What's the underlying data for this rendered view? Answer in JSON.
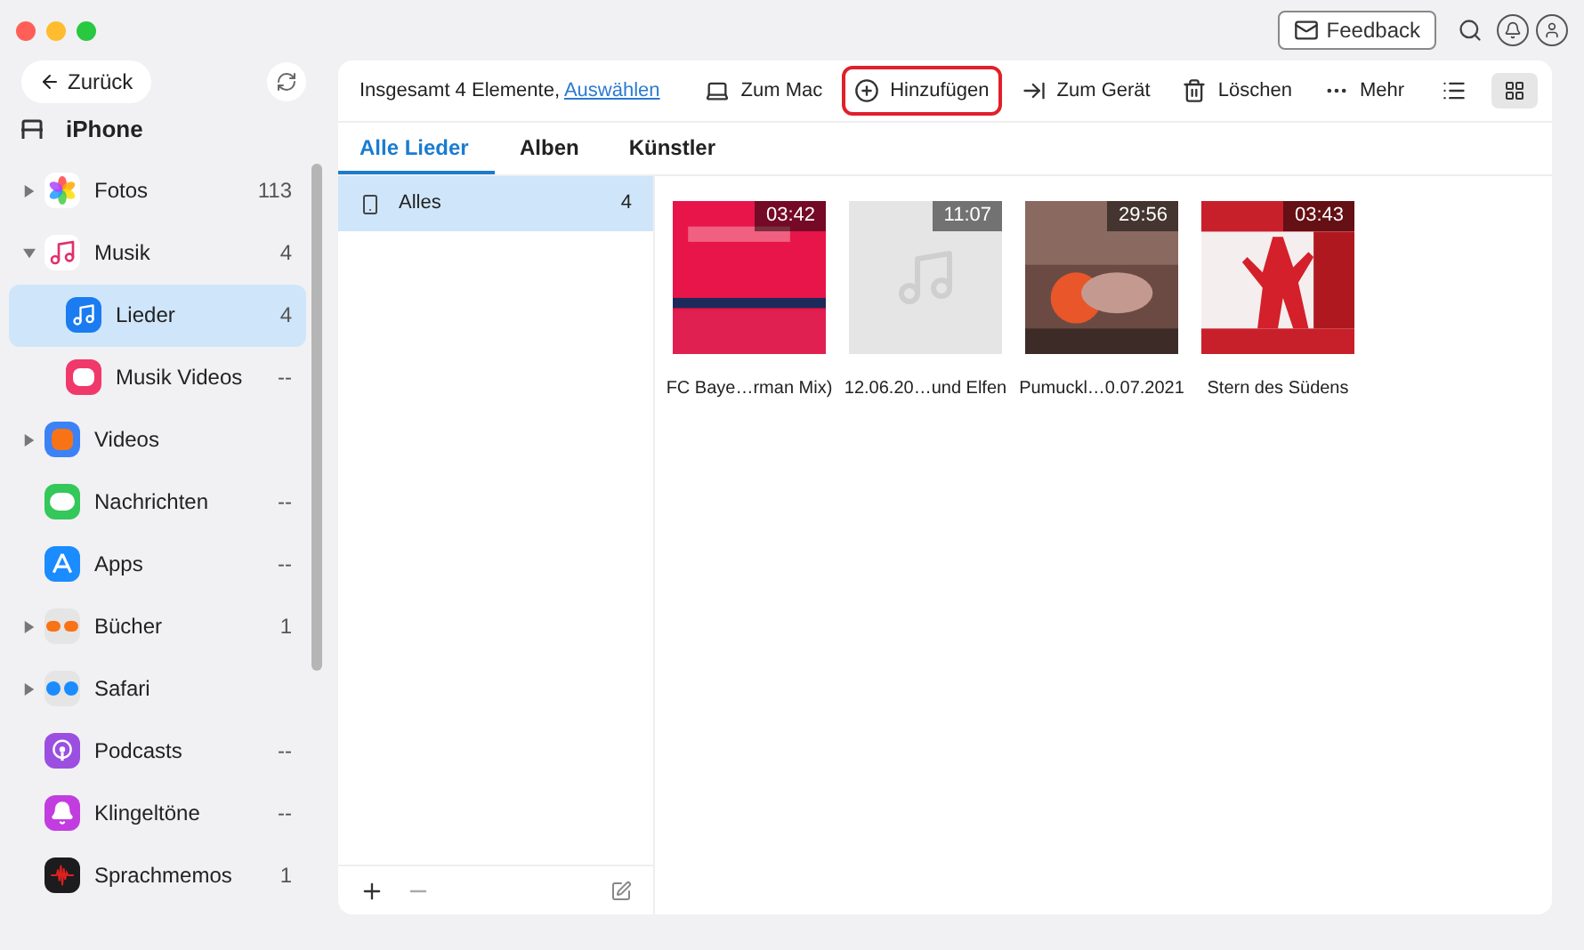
{
  "window": {
    "feedback_button": "Feedback"
  },
  "sidebar": {
    "back_button": "Zurück",
    "device": "iPhone",
    "items": [
      {
        "label": "Fotos",
        "count": "113",
        "kind": "folder",
        "expanded": false,
        "selected": false
      },
      {
        "label": "Musik",
        "count": "4",
        "kind": "folder",
        "expanded": true,
        "selected": false,
        "children": [
          {
            "label": "Lieder",
            "count": "4",
            "selected": true
          },
          {
            "label": "Musik Videos",
            "count": "--",
            "selected": false
          }
        ]
      },
      {
        "label": "Videos",
        "kind": "folder",
        "expanded": false,
        "selected": false
      },
      {
        "label": "Nachrichten",
        "count": "--",
        "kind": "item",
        "selected": false
      },
      {
        "label": "Apps",
        "count": "--",
        "kind": "item",
        "selected": false
      },
      {
        "label": "Bücher",
        "count": "1",
        "kind": "folder",
        "expanded": false,
        "selected": false
      },
      {
        "label": "Safari",
        "kind": "folder",
        "expanded": false,
        "selected": false
      },
      {
        "label": "Podcasts",
        "count": "--",
        "kind": "item",
        "selected": false
      },
      {
        "label": "Klingeltöne",
        "count": "--",
        "kind": "item",
        "selected": false
      },
      {
        "label": "Sprachmemos",
        "count": "1",
        "kind": "item",
        "selected": false
      }
    ]
  },
  "toolbar": {
    "summary": "Insgesamt 4 Elemente, ",
    "select_link": "Auswählen",
    "actions": [
      {
        "label": "Zum Mac",
        "highlighted": false
      },
      {
        "label": "Hinzufügen",
        "highlighted": true
      },
      {
        "label": "Zum Gerät",
        "highlighted": false
      },
      {
        "label": "Löschen",
        "highlighted": false
      },
      {
        "label": "Mehr",
        "highlighted": false
      }
    ],
    "views": [
      {
        "kind": "list",
        "selected": false
      },
      {
        "kind": "grid",
        "selected": true
      }
    ]
  },
  "tabs": [
    {
      "label": "Alle Lieder",
      "selected": true
    },
    {
      "label": "Alben",
      "selected": false
    },
    {
      "label": "Künstler",
      "selected": false
    }
  ],
  "playlists": [
    {
      "label": "Alles",
      "count": "4",
      "selected": true
    }
  ],
  "songs": [
    {
      "title": "FC Baye…rman Mix)",
      "duration": "03:42",
      "kind": "picture"
    },
    {
      "title": "12.06.20…und Elfen",
      "duration": "11:07",
      "kind": "placeholder"
    },
    {
      "title": "Pumuckl…0.07.2021",
      "duration": "29:56",
      "kind": "picture"
    },
    {
      "title": "Stern des Südens",
      "duration": "03:43",
      "kind": "picture"
    }
  ]
}
